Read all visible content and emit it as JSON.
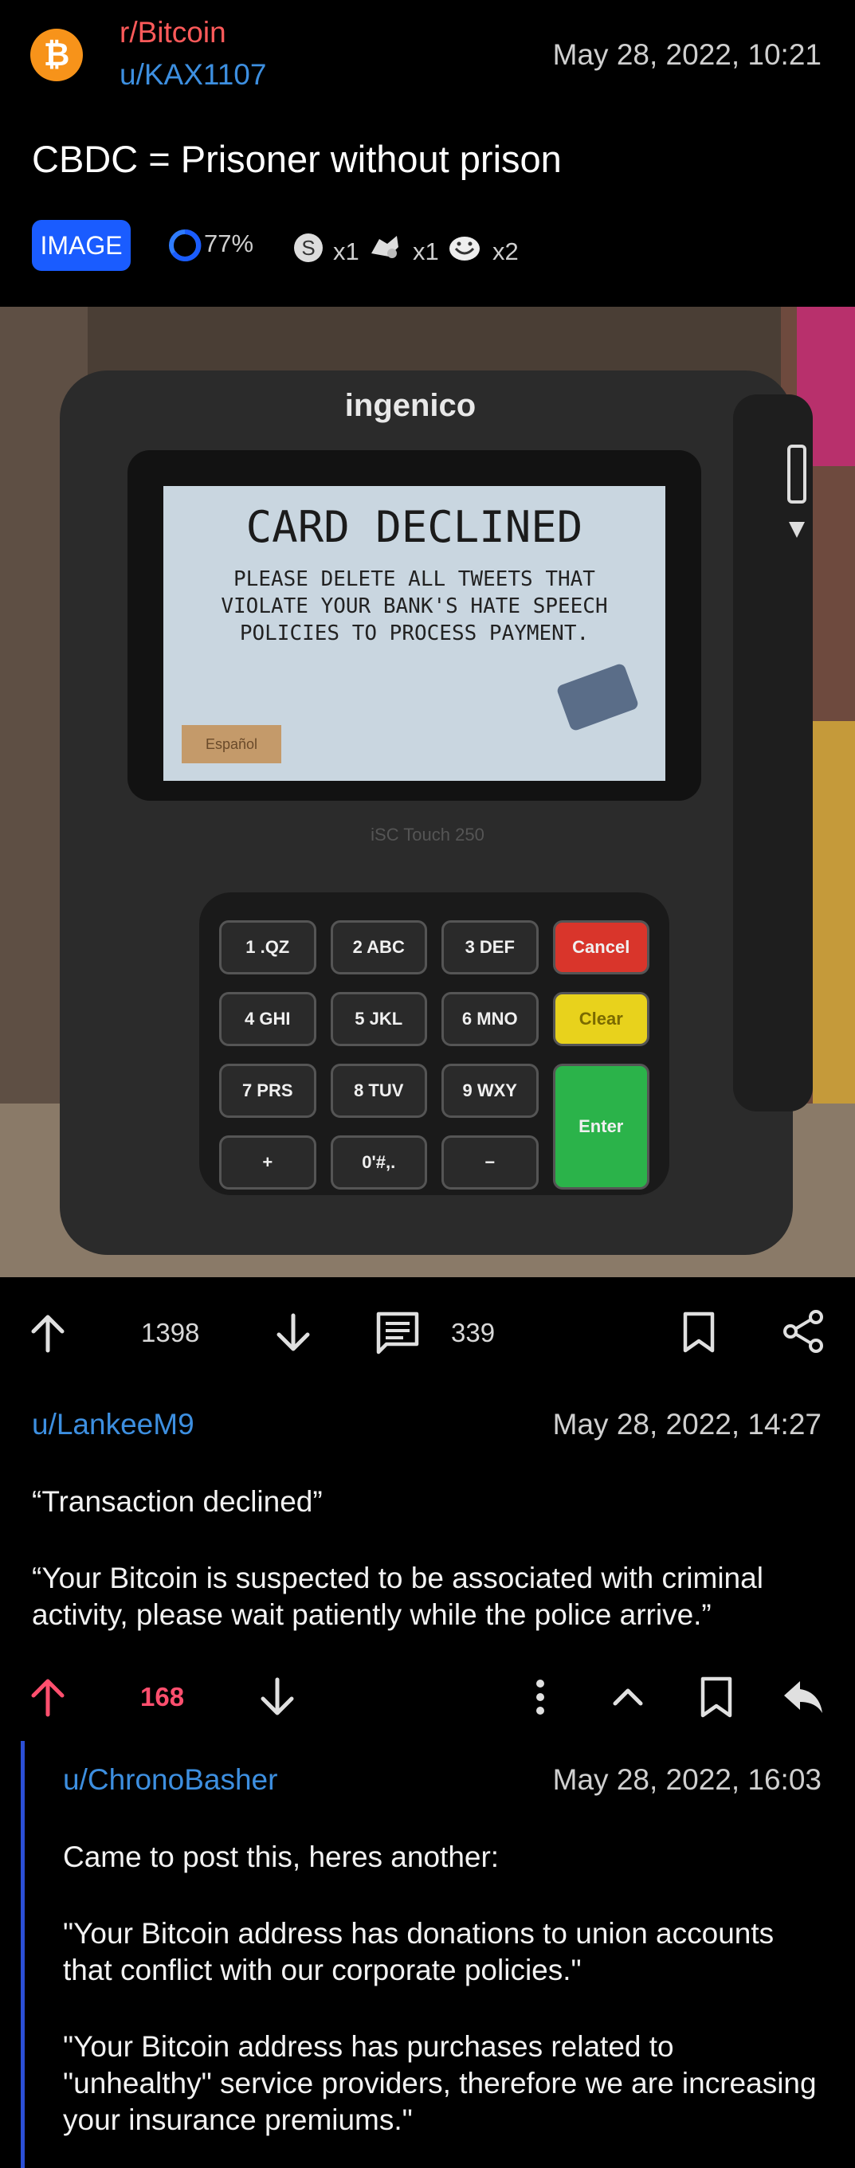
{
  "post": {
    "subreddit": "r/Bitcoin",
    "author": "u/KAX1107",
    "date": "May 28, 2022, 10:21",
    "title": "CBDC = Prisoner without prison",
    "tag": "IMAGE",
    "upvote_ratio": "77%",
    "awards": [
      {
        "icon": "silver-award-icon",
        "count": "x1"
      },
      {
        "icon": "helpful-award-icon",
        "count": "x1"
      },
      {
        "icon": "haha-award-icon",
        "count": "x2"
      }
    ],
    "score": "1398",
    "comment_count": "339"
  },
  "image": {
    "brand": "ingenico",
    "screen_title": "CARD DECLINED",
    "screen_message_lines": [
      "PLEASE DELETE ALL TWEETS THAT",
      "VIOLATE YOUR BANK'S HATE SPEECH",
      "POLICIES TO PROCESS PAYMENT."
    ],
    "screen_button": "Español",
    "model": "iSC Touch 250",
    "keys": [
      {
        "label": "1 .QZ",
        "color": "#2a2a2a"
      },
      {
        "label": "2 ABC",
        "color": "#2a2a2a"
      },
      {
        "label": "3 DEF",
        "color": "#2a2a2a"
      },
      {
        "label": "Cancel",
        "color": "#d9352b"
      },
      {
        "label": "4 GHI",
        "color": "#2a2a2a"
      },
      {
        "label": "5 JKL",
        "color": "#2a2a2a"
      },
      {
        "label": "6 MNO",
        "color": "#2a2a2a"
      },
      {
        "label": "Clear",
        "color": "#e8d21c"
      },
      {
        "label": "7 PRS",
        "color": "#2a2a2a"
      },
      {
        "label": "8 TUV",
        "color": "#2a2a2a"
      },
      {
        "label": "9 WXY",
        "color": "#2a2a2a"
      },
      {
        "label": "Enter",
        "color": "#2bb34a"
      },
      {
        "label": "+",
        "color": "#2a2a2a"
      },
      {
        "label": "0'#,.",
        "color": "#2a2a2a"
      },
      {
        "label": "−",
        "color": "#2a2a2a"
      }
    ]
  },
  "comments": [
    {
      "user": "u/LankeeM9",
      "date": "May 28, 2022, 14:27",
      "paragraphs": [
        "“Transaction declined”",
        "“Your Bitcoin is suspected to be associated with criminal activity, please wait patiently while the police arrive.”"
      ],
      "score": "168"
    },
    {
      "user": "u/ChronoBasher",
      "date": "May 28, 2022, 16:03",
      "paragraphs": [
        "Came to post this, heres another:",
        "\"Your Bitcoin address has donations to union accounts that conflict with our corporate policies.\"",
        "\"Your Bitcoin address has purchases related to \"unhealthy\" service providers, therefore we are increasing your insurance premiums.\""
      ]
    }
  ],
  "colors": {
    "background": "#000000",
    "link_blue": "#3d8fe0",
    "upvoted_red": "#ff4f6e",
    "tag_blue": "#1a5cff",
    "thread_line": "#2b4fd6"
  }
}
